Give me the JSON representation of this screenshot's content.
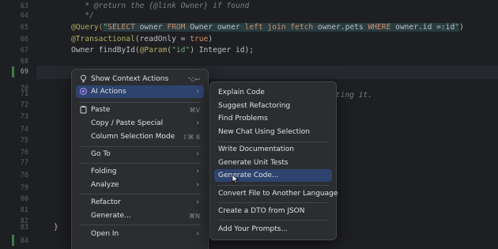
{
  "editor": {
    "line_numbers": [
      "63",
      "64",
      "65",
      "66",
      "67",
      "68",
      "69",
      "70",
      "71",
      "72",
      "73",
      "74",
      "75",
      "76",
      "77",
      "78",
      "79",
      "80",
      "81",
      "82",
      "83",
      "84"
    ],
    "current_line": "69",
    "code": {
      "l63_prefix": "* ",
      "l63_tag": "@return",
      "l63_mid": " the {",
      "l63_link": "@link",
      "l63_end": " Owner} if found",
      "l64": "*/",
      "l65_anno": "@Query(",
      "l65_q1": "\"",
      "l65_sql_select": "SELECT",
      "l65_owner1": " owner ",
      "l65_from": "FROM",
      "l65_owner2": " Owner owner ",
      "l65_left": "left join fetch",
      "l65_pets": " owner.pets ",
      "l65_where": "WHERE",
      "l65_id": " owner.id =:id",
      "l65_q2": "\"",
      "l65_close": ")",
      "l66_anno": "@Transactional",
      "l66_open": "(readOnly = ",
      "l66_true": "true",
      "l66_close": ")",
      "l67_a": "Owner findById(",
      "l67_anno": "@Param",
      "l67_b": "(",
      "l67_str": "\"id\"",
      "l67_c": ") Integer id);",
      "l83": "}",
      "trailing_comment": "ating it."
    }
  },
  "context_menu": {
    "items": [
      {
        "label": "Show Context Actions",
        "shortcut": "⌥↩",
        "icon": "bulb-icon"
      },
      {
        "label": "AI Actions",
        "arrow": "›",
        "icon": "ai-icon"
      },
      {
        "label": "Paste",
        "shortcut": "⌘V",
        "icon": "paste-icon"
      },
      {
        "label": "Copy / Paste Special",
        "arrow": "›"
      },
      {
        "label": "Column Selection Mode",
        "shortcut": "⇧⌘ 8"
      },
      {
        "label": "Go To",
        "arrow": "›"
      },
      {
        "label": "Folding",
        "arrow": "›"
      },
      {
        "label": "Analyze",
        "arrow": "›"
      },
      {
        "label": "Refactor",
        "arrow": "›"
      },
      {
        "label": "Generate...",
        "shortcut": "⌘N"
      },
      {
        "label": "Open In",
        "arrow": "›"
      }
    ]
  },
  "ai_submenu": {
    "items": [
      {
        "label": "Explain Code"
      },
      {
        "label": "Suggest Refactoring"
      },
      {
        "label": "Find Problems"
      },
      {
        "label": "New Chat Using Selection"
      },
      {
        "label": "Write Documentation"
      },
      {
        "label": "Generate Unit Tests"
      },
      {
        "label": "Generate Code..."
      },
      {
        "label": "Convert File to Another Language"
      },
      {
        "label": "Create a DTO from JSON"
      },
      {
        "label": "Add Your Prompts..."
      }
    ],
    "selected": "Generate Code..."
  },
  "colors": {
    "background": "#1e1f22",
    "menu_background": "#2b2d30",
    "selection": "#2e436e",
    "accent_ai": "#9b84e8"
  }
}
